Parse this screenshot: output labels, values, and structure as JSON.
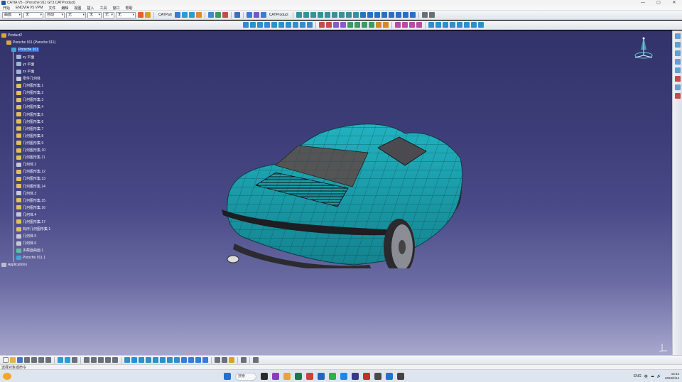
{
  "titlebar": {
    "title": "CATIA V5 - [Porsche 911 GT3.CATProduct]",
    "buttons": [
      "—",
      "▢",
      "✕"
    ]
  },
  "menubar": {
    "items": [
      "开始",
      "ENOVIA V5 VPM",
      "文件",
      "编辑",
      "视图",
      "插入",
      "工具",
      "窗口",
      "帮助"
    ]
  },
  "toolbar1": {
    "combos": [
      "曲面",
      "无",
      "自动",
      "无",
      "无",
      "无",
      "无"
    ],
    "checkboxes": [
      "CATPart",
      "CATProduct"
    ]
  },
  "tree": {
    "items": [
      {
        "label": "Product2",
        "indent": 0,
        "icon": "product-icon",
        "selected": false
      },
      {
        "label": "Porsche 911 (Porsche 911)",
        "indent": 1,
        "icon": "product-icon",
        "selected": false
      },
      {
        "label": "Porsche 911",
        "indent": 2,
        "icon": "part-icon",
        "selected": true
      },
      {
        "label": "xy 平面",
        "indent": 3,
        "icon": "plane-icon",
        "selected": false
      },
      {
        "label": "yz 平面",
        "indent": 3,
        "icon": "plane-icon",
        "selected": false
      },
      {
        "label": "zx 平面",
        "indent": 3,
        "icon": "plane-icon",
        "selected": false
      },
      {
        "label": "零件几何体",
        "indent": 3,
        "icon": "body-icon",
        "selected": false
      },
      {
        "label": "几何图形集.1",
        "indent": 3,
        "icon": "geoset-icon",
        "selected": false
      },
      {
        "label": "几何图形集.2",
        "indent": 3,
        "icon": "geoset-icon",
        "selected": false
      },
      {
        "label": "几何图形集.3",
        "indent": 3,
        "icon": "geoset-icon",
        "selected": false
      },
      {
        "label": "几何图形集.4",
        "indent": 3,
        "icon": "geoset-icon",
        "selected": false
      },
      {
        "label": "几何图形集.5",
        "indent": 3,
        "icon": "geoset-icon",
        "selected": false
      },
      {
        "label": "几何图形集.6",
        "indent": 3,
        "icon": "geoset-icon",
        "selected": false
      },
      {
        "label": "几何图形集.7",
        "indent": 3,
        "icon": "geoset-icon",
        "selected": false
      },
      {
        "label": "几何图形集.8",
        "indent": 3,
        "icon": "geoset-icon",
        "selected": false
      },
      {
        "label": "几何图形集.9",
        "indent": 3,
        "icon": "geoset-icon",
        "selected": false
      },
      {
        "label": "几何图形集.10",
        "indent": 3,
        "icon": "geoset-icon",
        "selected": false
      },
      {
        "label": "几何图形集.11",
        "indent": 3,
        "icon": "geoset-icon",
        "selected": false
      },
      {
        "label": "几何体.2",
        "indent": 3,
        "icon": "body-icon",
        "selected": false
      },
      {
        "label": "几何图形集.12",
        "indent": 3,
        "icon": "geoset-icon",
        "selected": false
      },
      {
        "label": "几何图形集.13",
        "indent": 3,
        "icon": "geoset-icon",
        "selected": false
      },
      {
        "label": "几何图形集.14",
        "indent": 3,
        "icon": "geoset-icon",
        "selected": false
      },
      {
        "label": "几何体.3",
        "indent": 3,
        "icon": "body-icon",
        "selected": false
      },
      {
        "label": "几何图形集.15",
        "indent": 3,
        "icon": "geoset-icon",
        "selected": false
      },
      {
        "label": "几何图形集.16",
        "indent": 3,
        "icon": "geoset-icon",
        "selected": false
      },
      {
        "label": "几何体.4",
        "indent": 3,
        "icon": "body-icon",
        "selected": false
      },
      {
        "label": "几何图形集.17",
        "indent": 3,
        "icon": "geoset-icon",
        "selected": false
      },
      {
        "label": "有序几何图形集.1",
        "indent": 3,
        "icon": "geoset-icon",
        "selected": false
      },
      {
        "label": "几何体.5",
        "indent": 3,
        "icon": "body-icon",
        "selected": false
      },
      {
        "label": "几何体.6",
        "indent": 3,
        "icon": "body-icon",
        "selected": false
      },
      {
        "label": "多截面曲面.1",
        "indent": 3,
        "icon": "surface-icon",
        "selected": false
      },
      {
        "label": "Porsche 911.1",
        "indent": 3,
        "icon": "part-icon",
        "selected": false
      },
      {
        "label": "Applications",
        "indent": 0,
        "icon": "applications-icon",
        "selected": false
      }
    ]
  },
  "statusbar": {
    "text": "选择对象或命令"
  },
  "taskbar": {
    "search_placeholder": "搜索",
    "tray_items": [
      "ENG",
      "英",
      "☁",
      "🔊"
    ],
    "time": "15:44",
    "date": "2023/2/14"
  },
  "colors": {
    "car_body": "#1a9aa6",
    "viewport_top": "#33336a",
    "viewport_bottom": "#a7a7ce",
    "selection": "#2f6fd0"
  }
}
